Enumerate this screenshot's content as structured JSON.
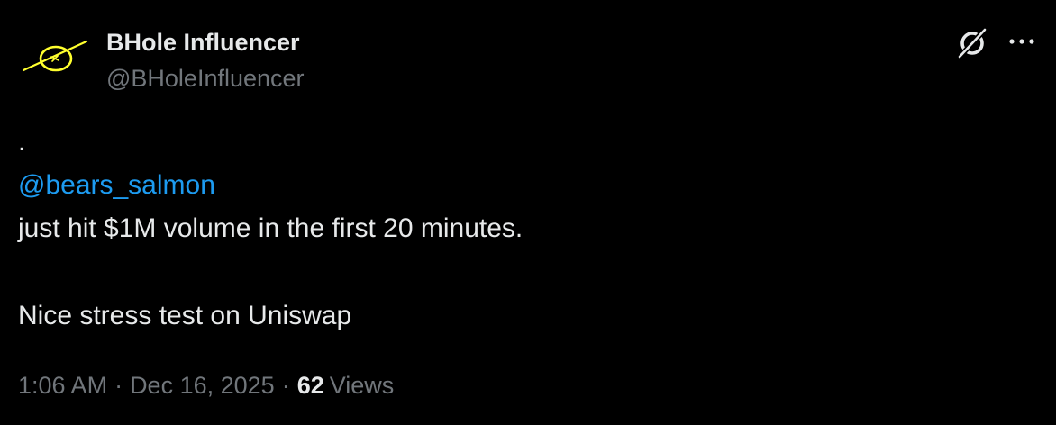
{
  "author": {
    "name": "BHole Influencer",
    "handle": "@BHoleInfluencer"
  },
  "tweet": {
    "line1": ".",
    "mention": "@bears_salmon",
    "line2": " just hit $1M volume in the first 20 minutes.",
    "line3": "Nice stress test on Uniswap"
  },
  "meta": {
    "time": "1:06 AM",
    "date": "Dec 16, 2025",
    "separator": "·",
    "views_count": "62",
    "views_label": "Views"
  },
  "icons": {
    "avatar": "yellow-circle-scribble-logo",
    "grok": "grok-icon",
    "more": "more-dots-icon"
  },
  "colors": {
    "background": "#000000",
    "text": "#e7e9ea",
    "secondary": "#71767b",
    "link": "#1d9bf0",
    "avatar": "#ffff2e"
  }
}
